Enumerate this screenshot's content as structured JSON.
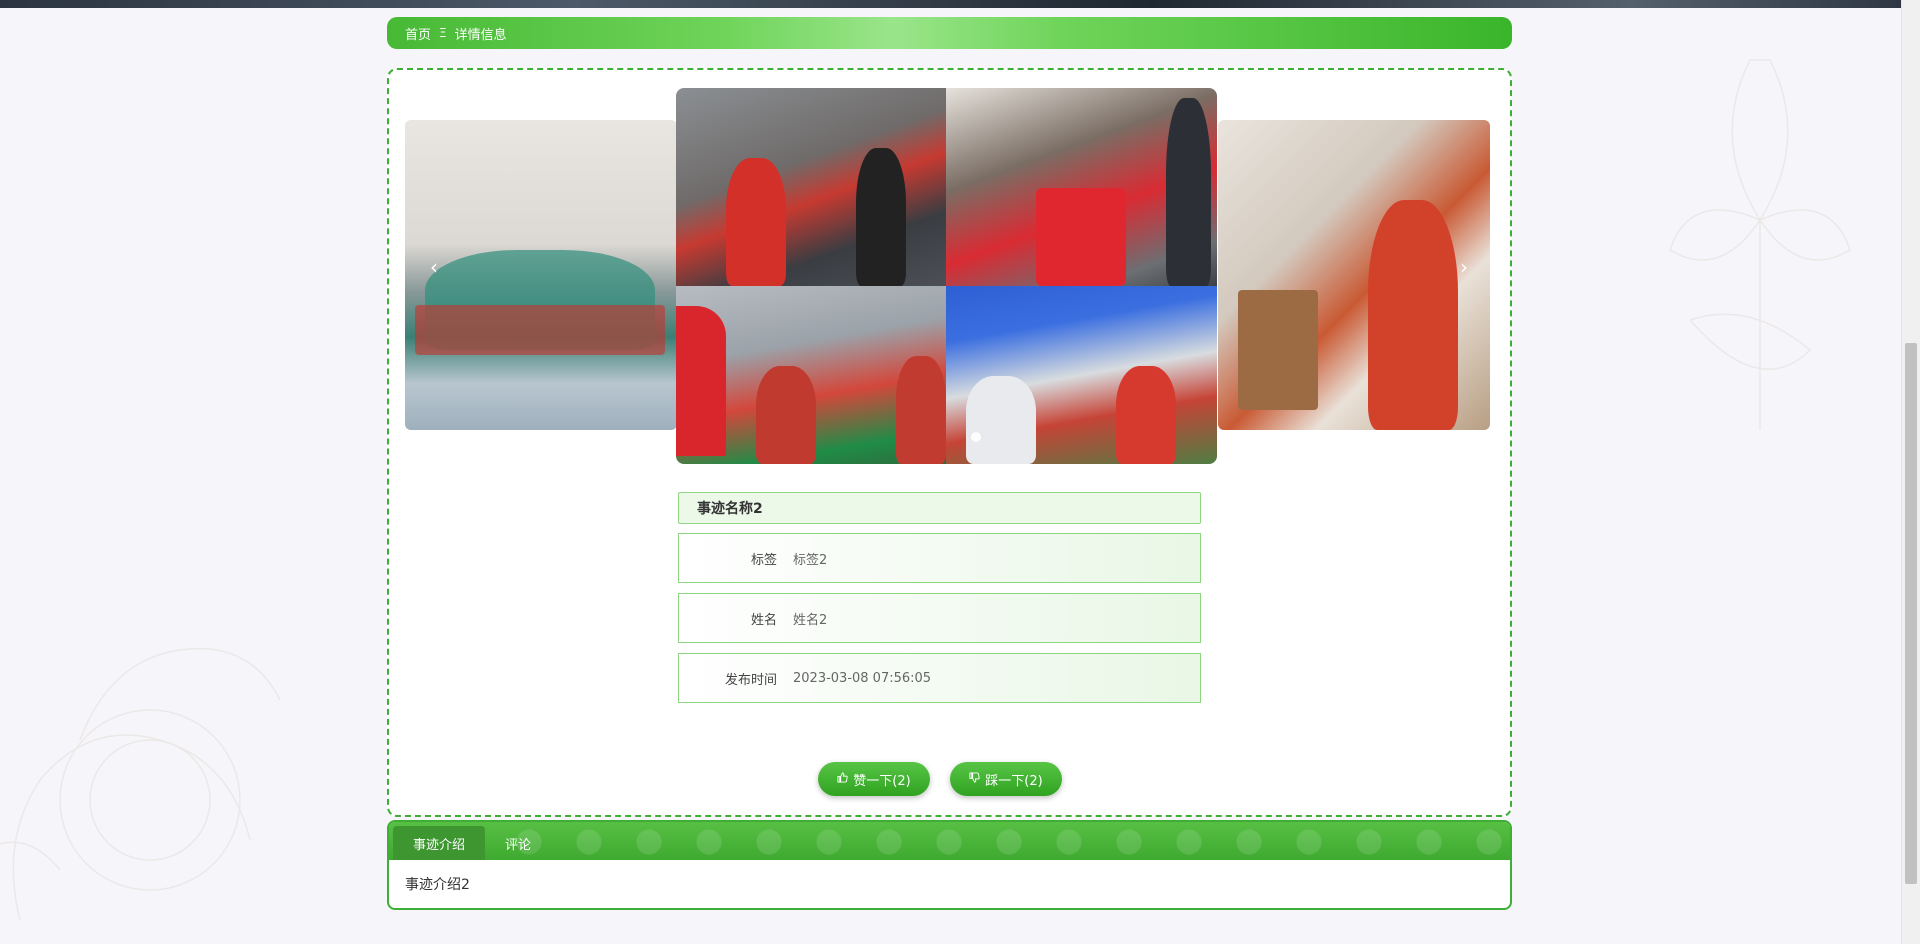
{
  "breadcrumb": {
    "home": "首页",
    "separator": "Ξ",
    "current": "详情信息"
  },
  "carousel": {
    "prev_icon": "chevron-left-icon",
    "next_icon": "chevron-right-icon",
    "prev_symbol": "‹",
    "next_symbol": "›",
    "slides": [
      "slide-left",
      "slide-center",
      "slide-right"
    ],
    "active_index": 0
  },
  "detail": {
    "title": "事迹名称2",
    "fields": [
      {
        "label": "标签",
        "value": "标签2"
      },
      {
        "label": "姓名",
        "value": "姓名2"
      },
      {
        "label": "发布时间",
        "value": "2023-03-08 07:56:05"
      }
    ]
  },
  "actions": {
    "like_icon": "thumbs-up-icon",
    "like_label": "赞一下(2)",
    "dislike_icon": "thumbs-down-icon",
    "dislike_label": "踩一下(2)"
  },
  "tabs": {
    "items": [
      {
        "label": "事迹介绍",
        "active": true
      },
      {
        "label": "评论",
        "active": false
      }
    ],
    "content": "事迹介绍2"
  },
  "colors": {
    "accent": "#3fae35",
    "accent_light": "#ecf9e9",
    "button": "#2fa320"
  }
}
